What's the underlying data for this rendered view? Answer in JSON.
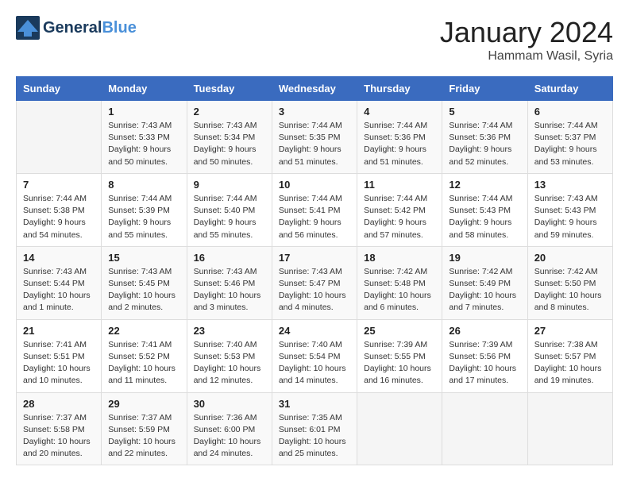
{
  "header": {
    "logo_line1": "General",
    "logo_line2": "Blue",
    "month": "January 2024",
    "location": "Hammam Wasil, Syria"
  },
  "weekdays": [
    "Sunday",
    "Monday",
    "Tuesday",
    "Wednesday",
    "Thursday",
    "Friday",
    "Saturday"
  ],
  "weeks": [
    [
      {
        "day": "",
        "info": ""
      },
      {
        "day": "1",
        "info": "Sunrise: 7:43 AM\nSunset: 5:33 PM\nDaylight: 9 hours\nand 50 minutes."
      },
      {
        "day": "2",
        "info": "Sunrise: 7:43 AM\nSunset: 5:34 PM\nDaylight: 9 hours\nand 50 minutes."
      },
      {
        "day": "3",
        "info": "Sunrise: 7:44 AM\nSunset: 5:35 PM\nDaylight: 9 hours\nand 51 minutes."
      },
      {
        "day": "4",
        "info": "Sunrise: 7:44 AM\nSunset: 5:36 PM\nDaylight: 9 hours\nand 51 minutes."
      },
      {
        "day": "5",
        "info": "Sunrise: 7:44 AM\nSunset: 5:36 PM\nDaylight: 9 hours\nand 52 minutes."
      },
      {
        "day": "6",
        "info": "Sunrise: 7:44 AM\nSunset: 5:37 PM\nDaylight: 9 hours\nand 53 minutes."
      }
    ],
    [
      {
        "day": "7",
        "info": "Sunrise: 7:44 AM\nSunset: 5:38 PM\nDaylight: 9 hours\nand 54 minutes."
      },
      {
        "day": "8",
        "info": "Sunrise: 7:44 AM\nSunset: 5:39 PM\nDaylight: 9 hours\nand 55 minutes."
      },
      {
        "day": "9",
        "info": "Sunrise: 7:44 AM\nSunset: 5:40 PM\nDaylight: 9 hours\nand 55 minutes."
      },
      {
        "day": "10",
        "info": "Sunrise: 7:44 AM\nSunset: 5:41 PM\nDaylight: 9 hours\nand 56 minutes."
      },
      {
        "day": "11",
        "info": "Sunrise: 7:44 AM\nSunset: 5:42 PM\nDaylight: 9 hours\nand 57 minutes."
      },
      {
        "day": "12",
        "info": "Sunrise: 7:44 AM\nSunset: 5:43 PM\nDaylight: 9 hours\nand 58 minutes."
      },
      {
        "day": "13",
        "info": "Sunrise: 7:43 AM\nSunset: 5:43 PM\nDaylight: 9 hours\nand 59 minutes."
      }
    ],
    [
      {
        "day": "14",
        "info": "Sunrise: 7:43 AM\nSunset: 5:44 PM\nDaylight: 10 hours\nand 1 minute."
      },
      {
        "day": "15",
        "info": "Sunrise: 7:43 AM\nSunset: 5:45 PM\nDaylight: 10 hours\nand 2 minutes."
      },
      {
        "day": "16",
        "info": "Sunrise: 7:43 AM\nSunset: 5:46 PM\nDaylight: 10 hours\nand 3 minutes."
      },
      {
        "day": "17",
        "info": "Sunrise: 7:43 AM\nSunset: 5:47 PM\nDaylight: 10 hours\nand 4 minutes."
      },
      {
        "day": "18",
        "info": "Sunrise: 7:42 AM\nSunset: 5:48 PM\nDaylight: 10 hours\nand 6 minutes."
      },
      {
        "day": "19",
        "info": "Sunrise: 7:42 AM\nSunset: 5:49 PM\nDaylight: 10 hours\nand 7 minutes."
      },
      {
        "day": "20",
        "info": "Sunrise: 7:42 AM\nSunset: 5:50 PM\nDaylight: 10 hours\nand 8 minutes."
      }
    ],
    [
      {
        "day": "21",
        "info": "Sunrise: 7:41 AM\nSunset: 5:51 PM\nDaylight: 10 hours\nand 10 minutes."
      },
      {
        "day": "22",
        "info": "Sunrise: 7:41 AM\nSunset: 5:52 PM\nDaylight: 10 hours\nand 11 minutes."
      },
      {
        "day": "23",
        "info": "Sunrise: 7:40 AM\nSunset: 5:53 PM\nDaylight: 10 hours\nand 12 minutes."
      },
      {
        "day": "24",
        "info": "Sunrise: 7:40 AM\nSunset: 5:54 PM\nDaylight: 10 hours\nand 14 minutes."
      },
      {
        "day": "25",
        "info": "Sunrise: 7:39 AM\nSunset: 5:55 PM\nDaylight: 10 hours\nand 16 minutes."
      },
      {
        "day": "26",
        "info": "Sunrise: 7:39 AM\nSunset: 5:56 PM\nDaylight: 10 hours\nand 17 minutes."
      },
      {
        "day": "27",
        "info": "Sunrise: 7:38 AM\nSunset: 5:57 PM\nDaylight: 10 hours\nand 19 minutes."
      }
    ],
    [
      {
        "day": "28",
        "info": "Sunrise: 7:37 AM\nSunset: 5:58 PM\nDaylight: 10 hours\nand 20 minutes."
      },
      {
        "day": "29",
        "info": "Sunrise: 7:37 AM\nSunset: 5:59 PM\nDaylight: 10 hours\nand 22 minutes."
      },
      {
        "day": "30",
        "info": "Sunrise: 7:36 AM\nSunset: 6:00 PM\nDaylight: 10 hours\nand 24 minutes."
      },
      {
        "day": "31",
        "info": "Sunrise: 7:35 AM\nSunset: 6:01 PM\nDaylight: 10 hours\nand 25 minutes."
      },
      {
        "day": "",
        "info": ""
      },
      {
        "day": "",
        "info": ""
      },
      {
        "day": "",
        "info": ""
      }
    ]
  ]
}
